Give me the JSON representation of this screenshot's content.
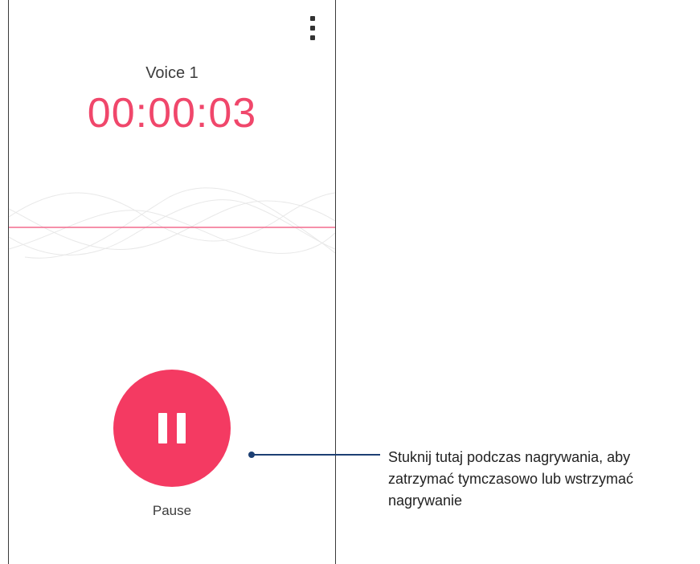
{
  "recorder": {
    "recording_name": "Voice 1",
    "elapsed_time": "00:00:03",
    "pause_label": "Pause",
    "accent_color": "#f43a62"
  },
  "icons": {
    "menu": "more-vert-icon",
    "pause": "pause-icon"
  },
  "annotation": {
    "text": "Stuknij tutaj podczas nagrywania, aby zatrzymać tymczasowo lub wstrzymać nagrywanie"
  }
}
